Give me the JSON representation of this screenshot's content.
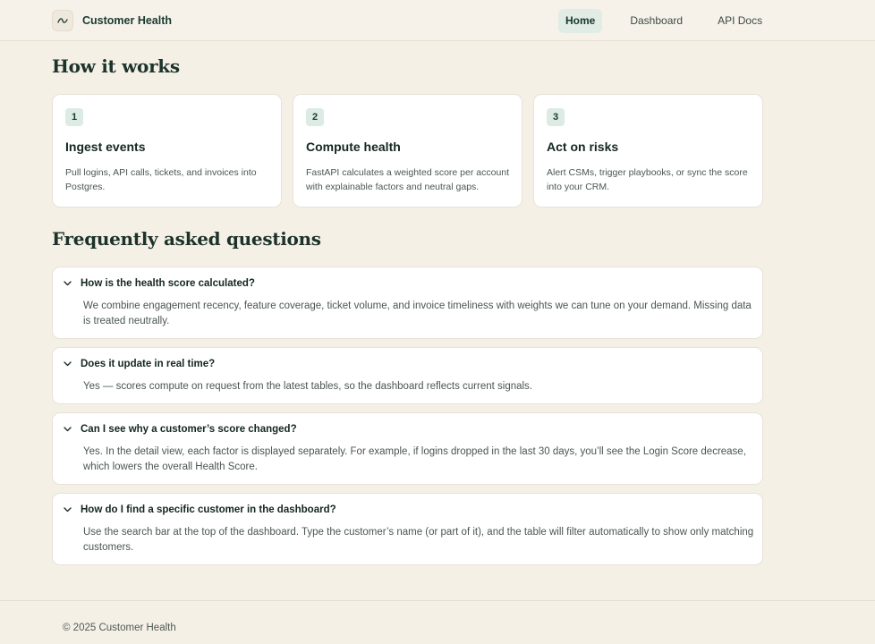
{
  "app": {
    "name": "Customer Health"
  },
  "nav": {
    "items": [
      "Home",
      "Dashboard",
      "API Docs"
    ],
    "active": "Home"
  },
  "how_it_works": {
    "title": "How it works",
    "steps": [
      {
        "number": "1",
        "title": "Ingest events",
        "description": "Pull logins, API calls, tickets, and invoices into Postgres."
      },
      {
        "number": "2",
        "title": "Compute health",
        "description": "FastAPI calculates a weighted score per account with explainable factors and neutral gaps."
      },
      {
        "number": "3",
        "title": "Act on risks",
        "description": "Alert CSMs, trigger playbooks, or sync the score into your CRM."
      }
    ]
  },
  "faq": {
    "title": "Frequently asked questions",
    "items": [
      {
        "question": "How is the health score calculated?",
        "answer": "We combine engagement recency, feature coverage, ticket volume, and invoice timeliness with weights we can tune on your demand. Missing data is treated neutrally."
      },
      {
        "question": "Does it update in real time?",
        "answer": "Yes — scores compute on request from the latest tables, so the dashboard reflects current signals."
      },
      {
        "question": "Can I see why a customer’s score changed?",
        "answer": "Yes. In the detail view, each factor is displayed separately. For example, if logins dropped in the last 30 days, you’ll see the Login Score decrease, which lowers the overall Health Score."
      },
      {
        "question": "How do I find a specific customer in the dashboard?",
        "answer": "Use the search bar at the top of the dashboard. Type the customer’s name (or part of it), and the table will filter automatically to show only matching customers."
      }
    ]
  },
  "footer": {
    "text": "© 2025 Customer Health"
  },
  "colors": {
    "background": "#f5f0e6",
    "accent": "#dcebe3",
    "heading": "#1c332b"
  }
}
